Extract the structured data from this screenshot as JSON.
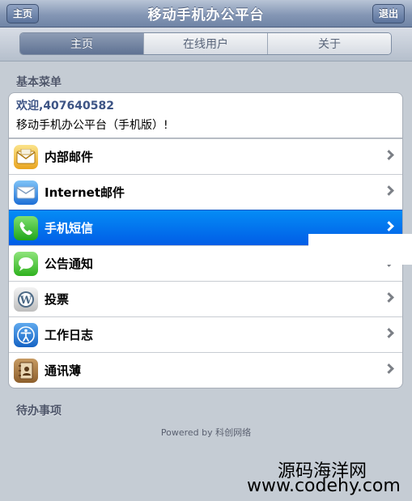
{
  "header": {
    "title": "移动手机办公平台",
    "left_button": "主页",
    "right_button": "退出"
  },
  "tabs": [
    {
      "label": "主页",
      "active": true
    },
    {
      "label": "在线用户",
      "active": false
    },
    {
      "label": "关于",
      "active": false
    }
  ],
  "basic_menu": {
    "section_title": "基本菜单",
    "welcome": "欢迎,407640582",
    "platform_text": "移动手机办公平台（手机版）!",
    "items": [
      {
        "label": "内部邮件",
        "icon": "mail-icon"
      },
      {
        "label": "Internet邮件",
        "icon": "internet-mail-icon"
      },
      {
        "label": "手机短信",
        "icon": "phone-icon",
        "selected": true
      },
      {
        "label": "公告通知",
        "icon": "message-bubble-icon"
      },
      {
        "label": "投票",
        "icon": "wordpress-icon"
      },
      {
        "label": "工作日志",
        "icon": "accessibility-icon"
      },
      {
        "label": "通讯薄",
        "icon": "address-book-icon"
      }
    ]
  },
  "todo": {
    "section_title": "待办事项"
  },
  "footer": {
    "powered_by": "Powered by 科创网络"
  },
  "watermark": {
    "line1": "源码海洋网",
    "line2": "www.codehy.com"
  },
  "colors": {
    "nav_bar": "#7f92b2",
    "selected_row": "#0277ee",
    "background": "#c5ccd4"
  }
}
